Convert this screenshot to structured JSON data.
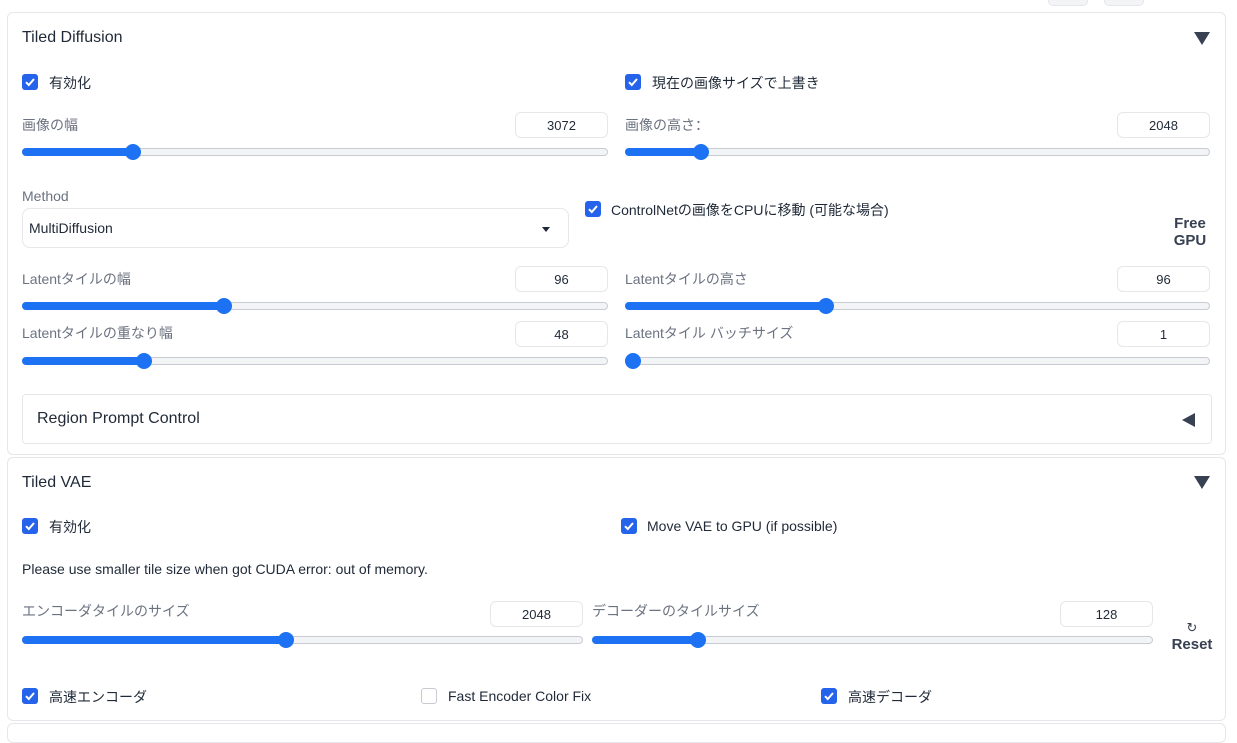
{
  "tiled_diffusion": {
    "title": "Tiled Diffusion",
    "enable": {
      "label": "有効化",
      "checked": true
    },
    "overwrite_size": {
      "label": "現在の画像サイズで上書き",
      "checked": true
    },
    "image_width": {
      "label": "画像の幅",
      "value": "3072",
      "fraction": 0.18
    },
    "image_height": {
      "label": "画像の高さ：",
      "value": "2048",
      "fraction": 0.12
    },
    "method": {
      "label": "Method",
      "value": "MultiDiffusion"
    },
    "controlnet_cpu": {
      "label": "ControlNetの画像をCPUに移動 (可能な場合)",
      "checked": true
    },
    "free_gpu": {
      "line1": "Free",
      "line2": "GPU"
    },
    "latent_tile_width": {
      "label": "Latentタイルの幅",
      "value": "96",
      "fraction": 0.34
    },
    "latent_tile_height": {
      "label": "Latentタイルの高さ",
      "value": "96",
      "fraction": 0.34
    },
    "latent_tile_overlap": {
      "label": "Latentタイルの重なり幅",
      "value": "48",
      "fraction": 0.2
    },
    "latent_tile_batch": {
      "label": "Latentタイル バッチサイズ",
      "value": "1",
      "fraction": 0.0
    },
    "region_prompt": {
      "label": "Region Prompt Control"
    }
  },
  "tiled_vae": {
    "title": "Tiled VAE",
    "enable": {
      "label": "有効化",
      "checked": true
    },
    "move_vae_gpu": {
      "label": "Move VAE to GPU (if possible)",
      "checked": true
    },
    "note": "Please use smaller tile size when got CUDA error: out of memory.",
    "encoder_tile": {
      "label": "エンコーダタイルのサイズ",
      "value": "2048",
      "fraction": 0.47
    },
    "decoder_tile": {
      "label": "デコーダーのタイルサイズ",
      "value": "128",
      "fraction": 0.18
    },
    "reset": {
      "icon": "↻",
      "label": "Reset"
    },
    "fast_encoder": {
      "label": "高速エンコーダ",
      "checked": true
    },
    "fast_encoder_color_fix": {
      "label": "Fast Encoder Color Fix",
      "checked": false
    },
    "fast_decoder": {
      "label": "高速デコーダ",
      "checked": true
    }
  }
}
